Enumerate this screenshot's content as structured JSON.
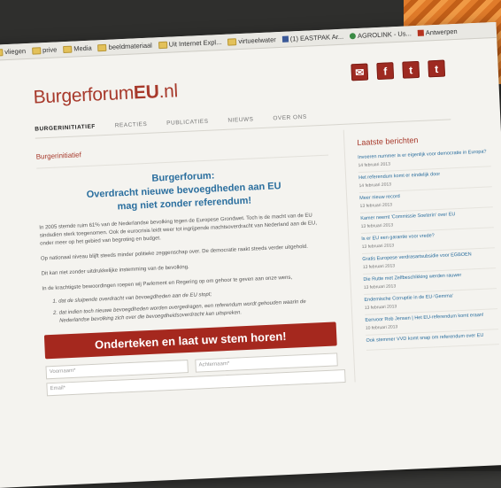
{
  "bookmarks": [
    {
      "label": "vliegen",
      "icon": "folder-icon"
    },
    {
      "label": "prive",
      "icon": "folder-icon"
    },
    {
      "label": "Media",
      "icon": "folder-icon"
    },
    {
      "label": "beeldmateriaal",
      "icon": "folder-icon"
    },
    {
      "label": "Uit Internet Expl...",
      "icon": "folder-icon"
    },
    {
      "label": "virtueelwater",
      "icon": "folder-icon"
    },
    {
      "label": "(1) EASTPAK Ar...",
      "icon": "facebook-icon"
    },
    {
      "label": "AGROLINK - Us...",
      "icon": "globe-icon"
    },
    {
      "label": "Antwerpen",
      "icon": "bookmark-icon"
    }
  ],
  "site": {
    "logo_main": "Burgerforum",
    "logo_eu": "EU",
    "logo_tld": ".nl",
    "social": [
      "✉",
      "f",
      "t",
      "t"
    ],
    "nav": [
      "BURGERINITIATIEF",
      "REACTIES",
      "PUBLICATIES",
      "NIEUWS",
      "OVER ONS"
    ]
  },
  "main": {
    "breadcrumb": "Burgerinitiatief",
    "headline_1": "Burgerforum:",
    "headline_2": "Overdracht nieuwe bevoegdheden aan EU",
    "headline_3": "mag niet zonder referendum!",
    "para_1": "In 2005 stemde ruim 61% van de Nederlandse bevolking tegen de Europese Grondwet. Toch is de macht van de EU sindsdien sterk toegenomen. Ook de eurocrisis leidt weer tot ingrijpende machtsoverdracht van Nederland aan de EU, onder meer op het gebied van begroting en budget.",
    "para_2": "Op nationaal niveau blijft steeds minder politieke zeggenschap over. De democratie raakt steeds verder uitgehold.",
    "para_3": "Dit kan niet zonder uitdrukkelijke instemming van de bevolking.",
    "para_4": "In de krachtigste bewoordingen roepen wij Parlement en Regering op om gehoor te geven aan onze wens,",
    "item_1": "dat de sluipende overdracht van bevoegdheden aan de EU stopt;",
    "item_2": "dat indien toch nieuwe bevoegdheden worden overgedragen, een referendum wordt gehouden waarin de Nederlandse bevolking zich over die bevoegdheidsoverdracht kan uitspreken.",
    "cta": "Onderteken en laat uw stem horen!",
    "first_name_placeholder": "Voornaam*",
    "last_name_placeholder": "Achternaam*",
    "email_placeholder": "Email*"
  },
  "sidebar": {
    "title": "Laatste berichten",
    "posts": [
      {
        "title": "Invoeren nummer is er eigenlijk voor democratie in Europa?",
        "date": "14 februari 2013"
      },
      {
        "title": "Het referendum komt er eindelijk door",
        "date": "14 februari 2013"
      },
      {
        "title": "Meer nieuw record",
        "date": "13 februari 2013"
      },
      {
        "title": "Kamer neemt 'Commissie Soeterin' over EU",
        "date": "13 februari 2013"
      },
      {
        "title": "Is er EU een garantie voor vrede?",
        "date": "13 februari 2013"
      },
      {
        "title": "Gratis Europese verdrasartsubsidie voor EGBOEN",
        "date": "13 februari 2013"
      },
      {
        "title": "Die Rutte met Zelfbeschikking werden rauwer",
        "date": "13 februari 2013"
      },
      {
        "title": "Endemische Corruptie in de EU-'Gemma'",
        "date": "13 februari 2013"
      },
      {
        "title": "Eenvoor Rob Jensen | Het EU-referendum komt eraan!",
        "date": "10 februari 2013"
      },
      {
        "title": "Ook stemmer VVD komt snap om referendum over EU",
        "date": ""
      }
    ]
  },
  "colors": {
    "brand_red": "#a5281e",
    "headline_blue": "#2a6e9e"
  }
}
